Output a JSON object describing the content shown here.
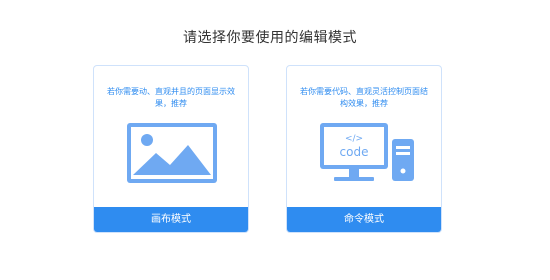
{
  "page": {
    "title": "请选择你要使用的编辑模式"
  },
  "cards": [
    {
      "description": "若你需要动、直观并且的页面显示效果，推荐",
      "button_label": "画布模式",
      "icon": "image-icon"
    },
    {
      "description": "若你需要代码、直观灵活控制页面结构效果，推荐",
      "button_label": "命令模式",
      "icon": "computer-code-icon",
      "code_text": "code",
      "code_tag": "</>"
    }
  ],
  "colors": {
    "accent": "#2f8cf0",
    "illustration": "#6fa9f2",
    "card_border": "#cfe2fb"
  }
}
